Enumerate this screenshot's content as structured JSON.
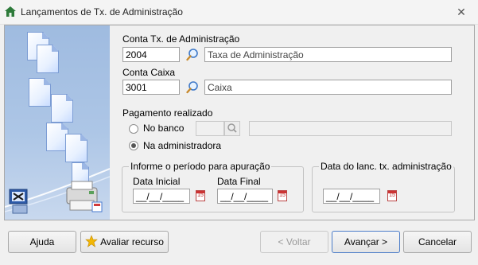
{
  "window": {
    "title": "Lançamentos de Tx. de Administração",
    "icon": "house-icon",
    "close_glyph": "✕"
  },
  "form": {
    "conta_tx": {
      "label": "Conta Tx. de Administração",
      "code": "2004",
      "description": "Taxa de Administração"
    },
    "conta_caixa": {
      "label": "Conta Caixa",
      "code": "3001",
      "description": "Caixa"
    },
    "pagamento": {
      "label": "Pagamento realizado",
      "options": [
        {
          "label": "No banco",
          "checked": false
        },
        {
          "label": "Na administradora",
          "checked": true
        }
      ],
      "bank_code": "",
      "bank_name": ""
    },
    "periodo": {
      "legend": "Informe o período para apuração",
      "inicial_label": "Data Inicial",
      "inicial_value": "__/__/____",
      "final_label": "Data Final",
      "final_value": "__/__/____"
    },
    "lancamento": {
      "legend": "Data do lanc. tx. administração",
      "value": "__/__/____"
    },
    "calendar_glyph": "15"
  },
  "buttons": {
    "help": "Ajuda",
    "rate": "Avaliar recurso",
    "back": "< Voltar",
    "next": "Avançar >",
    "cancel": "Cancelar"
  },
  "colors": {
    "accent": "#4b7cc8",
    "side_panel": "#a9c2e4",
    "star": "#f2b705"
  }
}
